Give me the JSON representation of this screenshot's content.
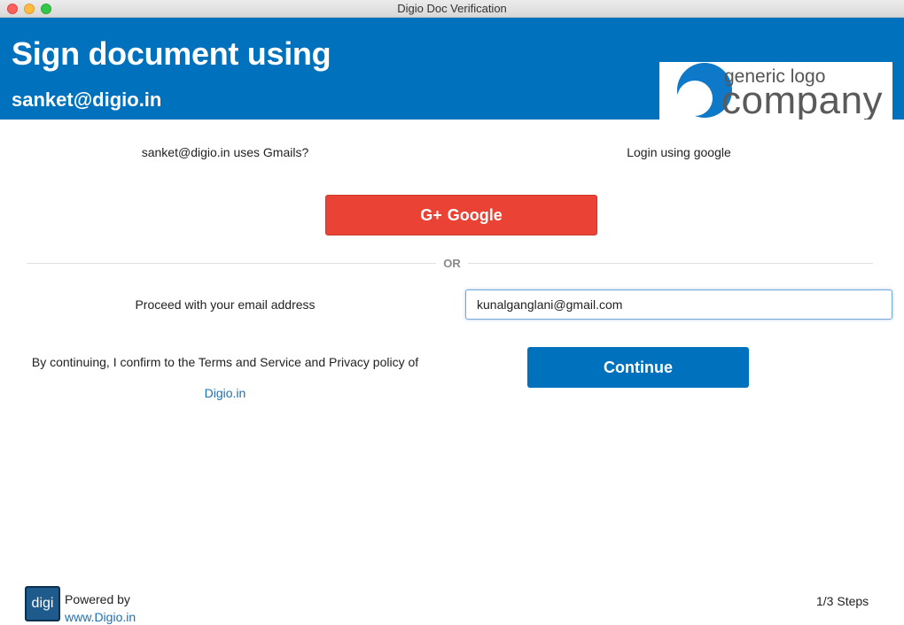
{
  "window": {
    "title": "Digio Doc Verification"
  },
  "header": {
    "title": "Sign document using",
    "email": "sanket@digio.in",
    "logo": {
      "small_text": "generic logo",
      "big_text": "company",
      "color": "#0e79c9"
    },
    "background": "#0071bc"
  },
  "google_section": {
    "question": "sanket@digio.in uses Gmails?",
    "login_label": "Login using google",
    "button_icon": "G+",
    "button_label": "Google",
    "button_color": "#ea4335"
  },
  "divider": {
    "label": "OR"
  },
  "email_section": {
    "prompt": "Proceed with your email address",
    "input_value": "kunalganglani@gmail.com"
  },
  "terms": {
    "text": "By continuing, I confirm to the Terms and Service and Privacy policy of",
    "link": "Digio.in"
  },
  "continue_button": {
    "label": "Continue"
  },
  "footer": {
    "logo_text": "digi",
    "powered_by": "Powered by",
    "link": "www.Digio.in",
    "steps": "1/3 Steps"
  }
}
